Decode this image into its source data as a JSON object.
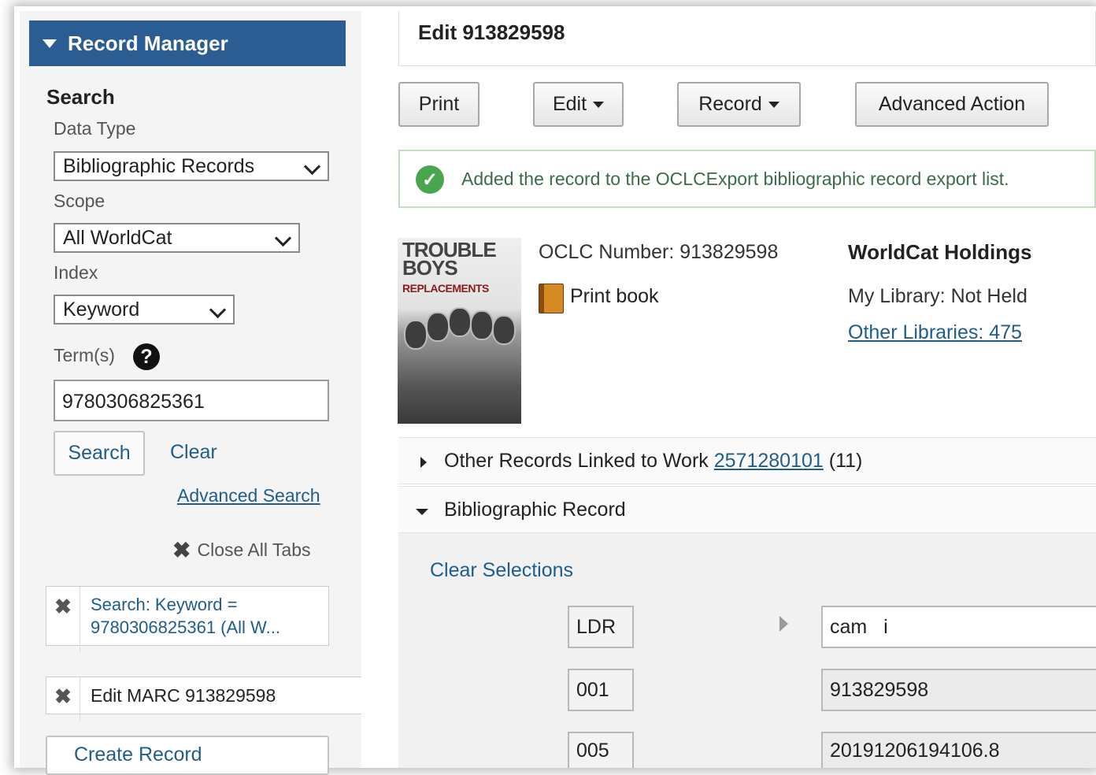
{
  "sidebar": {
    "title": "Record Manager",
    "search_heading": "Search",
    "data_type_label": "Data Type",
    "data_type_value": "Bibliographic Records",
    "scope_label": "Scope",
    "scope_value": "All WorldCat",
    "index_label": "Index",
    "index_value": "Keyword",
    "terms_label": "Term(s)",
    "terms_value": "9780306825361",
    "search_button": "Search",
    "clear_link": "Clear",
    "advanced_search_link": "Advanced Search",
    "close_all_tabs": "Close All Tabs",
    "open_tabs": [
      {
        "line1": "Search: Keyword =",
        "line2": "9780306825361 (All W..."
      },
      {
        "label": "Edit MARC 913829598"
      }
    ],
    "create_record": "Create Record"
  },
  "main": {
    "title": "Edit 913829598",
    "toolbar": {
      "print": "Print",
      "edit": "Edit",
      "record": "Record",
      "advanced_action": "Advanced Action"
    },
    "alert": "Added the record to the OCLCExport bibliographic record export list.",
    "cover": {
      "title": "TROUBLE BOYS",
      "subtitle": "REPLACEMENTS"
    },
    "oclc_number": "OCLC Number: 913829598",
    "format": "Print book",
    "holdings": {
      "title": "WorldCat Holdings",
      "my_library": "My Library: Not Held",
      "other_libraries": "Other Libraries: 475"
    },
    "linked_work": {
      "prefix": "Other Records Linked to Work ",
      "work_id": "2571280101",
      "count": " (11)"
    },
    "bib_record_label": "Bibliographic Record",
    "clear_selections": "Clear Selections",
    "fields": [
      {
        "tag": "LDR",
        "value": "cam   i"
      },
      {
        "tag": "001",
        "value": "913829598"
      },
      {
        "tag": "005",
        "value": "20191206194106.8"
      }
    ]
  },
  "colors": {
    "header_blue": "#2b5c92",
    "link_blue": "#1f5d8d",
    "success_green": "#4aa64e"
  }
}
